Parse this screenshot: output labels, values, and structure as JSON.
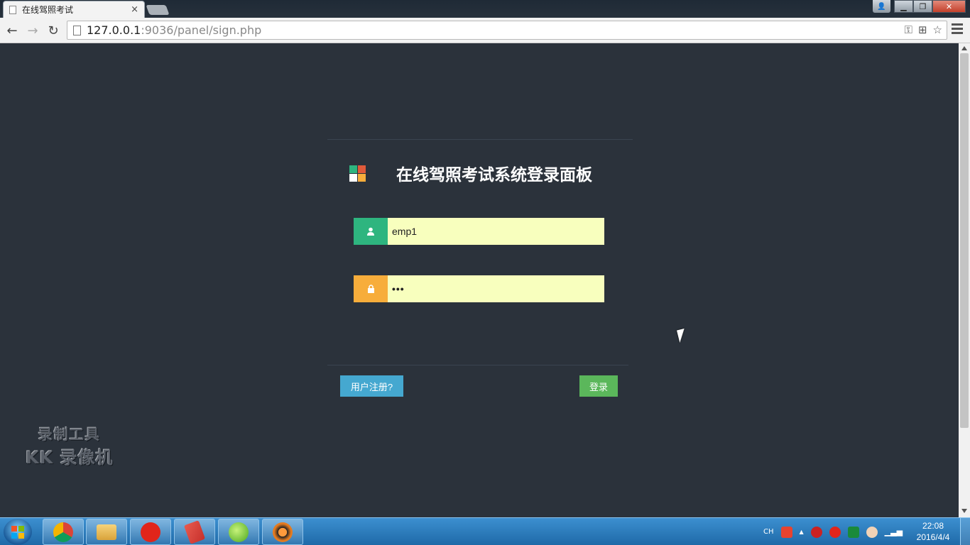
{
  "browser": {
    "tab_title": "在线驾照考试",
    "tab_close": "×",
    "url_host": "127.0.0.1",
    "url_rest": ":9036/panel/sign.php"
  },
  "page": {
    "title": "在线驾照考试系统登录面板",
    "username_value": "emp1",
    "password_value": "•••",
    "register_label": "用户注册?",
    "login_label": "登录"
  },
  "watermark": {
    "line1": "录制工具",
    "line2": "KK 录像机"
  },
  "taskbar": {
    "tray_lang": "CH",
    "time": "22:08",
    "date": "2016/4/4"
  },
  "colors": {
    "background": "#2b323b",
    "input_bg": "#f8ffbe",
    "user_addon": "#2eb57f",
    "lock_addon": "#f7ad3b",
    "register_btn": "#45a8d0",
    "login_btn": "#5bb75b"
  }
}
